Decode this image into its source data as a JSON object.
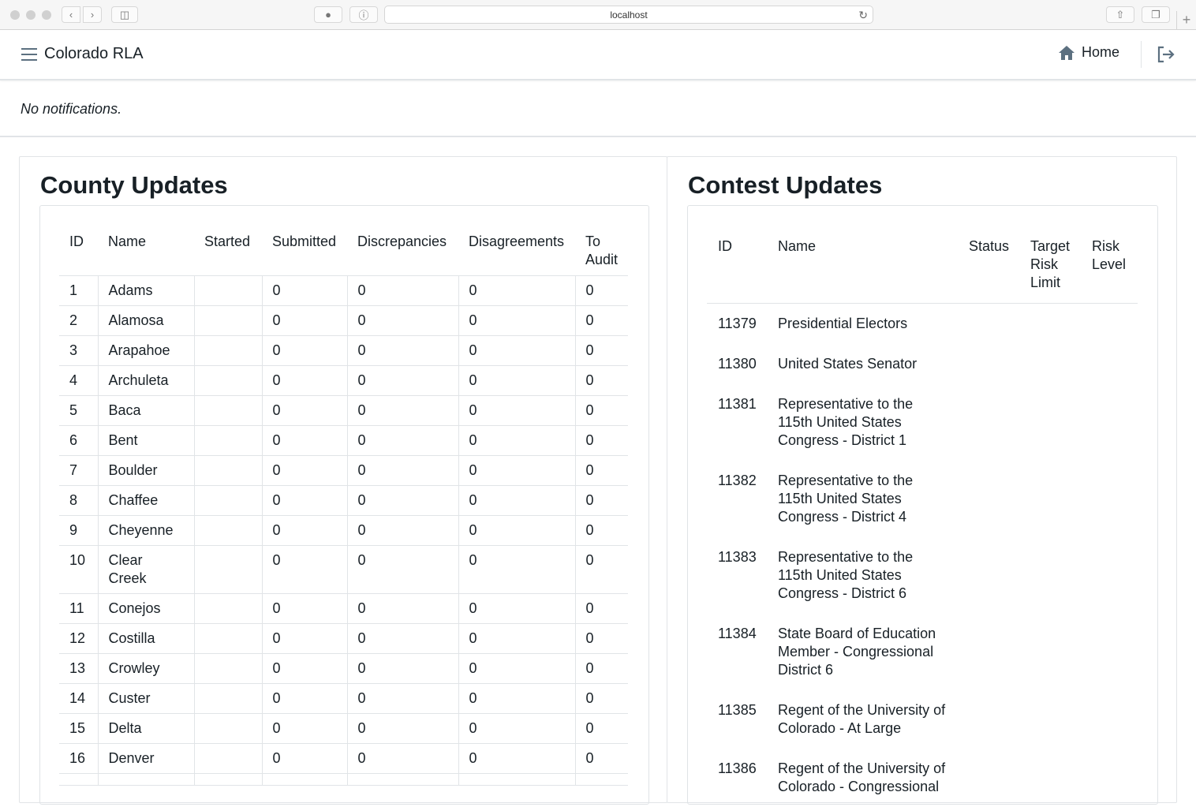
{
  "browser": {
    "url": "localhost"
  },
  "nav": {
    "title": "Colorado RLA",
    "home_label": "Home"
  },
  "notifications": {
    "text": "No notifications."
  },
  "county_updates": {
    "title": "County Updates",
    "columns": [
      "ID",
      "Name",
      "Started",
      "Submitted",
      "Discrepancies",
      "Disagreements",
      "To Audit"
    ],
    "rows": [
      [
        "1",
        "Adams",
        "",
        "0",
        "0",
        "0",
        "0"
      ],
      [
        "2",
        "Alamosa",
        "",
        "0",
        "0",
        "0",
        "0"
      ],
      [
        "3",
        "Arapahoe",
        "",
        "0",
        "0",
        "0",
        "0"
      ],
      [
        "4",
        "Archuleta",
        "",
        "0",
        "0",
        "0",
        "0"
      ],
      [
        "5",
        "Baca",
        "",
        "0",
        "0",
        "0",
        "0"
      ],
      [
        "6",
        "Bent",
        "",
        "0",
        "0",
        "0",
        "0"
      ],
      [
        "7",
        "Boulder",
        "",
        "0",
        "0",
        "0",
        "0"
      ],
      [
        "8",
        "Chaffee",
        "",
        "0",
        "0",
        "0",
        "0"
      ],
      [
        "9",
        "Cheyenne",
        "",
        "0",
        "0",
        "0",
        "0"
      ],
      [
        "10",
        "Clear Creek",
        "",
        "0",
        "0",
        "0",
        "0"
      ],
      [
        "11",
        "Conejos",
        "",
        "0",
        "0",
        "0",
        "0"
      ],
      [
        "12",
        "Costilla",
        "",
        "0",
        "0",
        "0",
        "0"
      ],
      [
        "13",
        "Crowley",
        "",
        "0",
        "0",
        "0",
        "0"
      ],
      [
        "14",
        "Custer",
        "",
        "0",
        "0",
        "0",
        "0"
      ],
      [
        "15",
        "Delta",
        "",
        "0",
        "0",
        "0",
        "0"
      ],
      [
        "16",
        "Denver",
        "",
        "0",
        "0",
        "0",
        "0"
      ],
      [
        "",
        "",
        "",
        "",
        "",
        "",
        ""
      ]
    ]
  },
  "contest_updates": {
    "title": "Contest Updates",
    "columns": [
      "ID",
      "Name",
      "Status",
      "Target Risk Limit",
      "Risk Level"
    ],
    "rows": [
      [
        "11379",
        "Presidential Electors",
        "",
        "",
        ""
      ],
      [
        "11380",
        "United States Senator",
        "",
        "",
        ""
      ],
      [
        "11381",
        "Representative to the 115th United States Congress - District 1",
        "",
        "",
        ""
      ],
      [
        "11382",
        "Representative to the 115th United States Congress - District 4",
        "",
        "",
        ""
      ],
      [
        "11383",
        "Representative to the 115th United States Congress - District 6",
        "",
        "",
        ""
      ],
      [
        "11384",
        "State Board of Education Member - Congressional District 6",
        "",
        "",
        ""
      ],
      [
        "11385",
        "Regent of the University of Colorado - At Large",
        "",
        "",
        ""
      ],
      [
        "11386",
        "Regent of the University of Colorado - Congressional",
        "",
        "",
        ""
      ]
    ]
  }
}
